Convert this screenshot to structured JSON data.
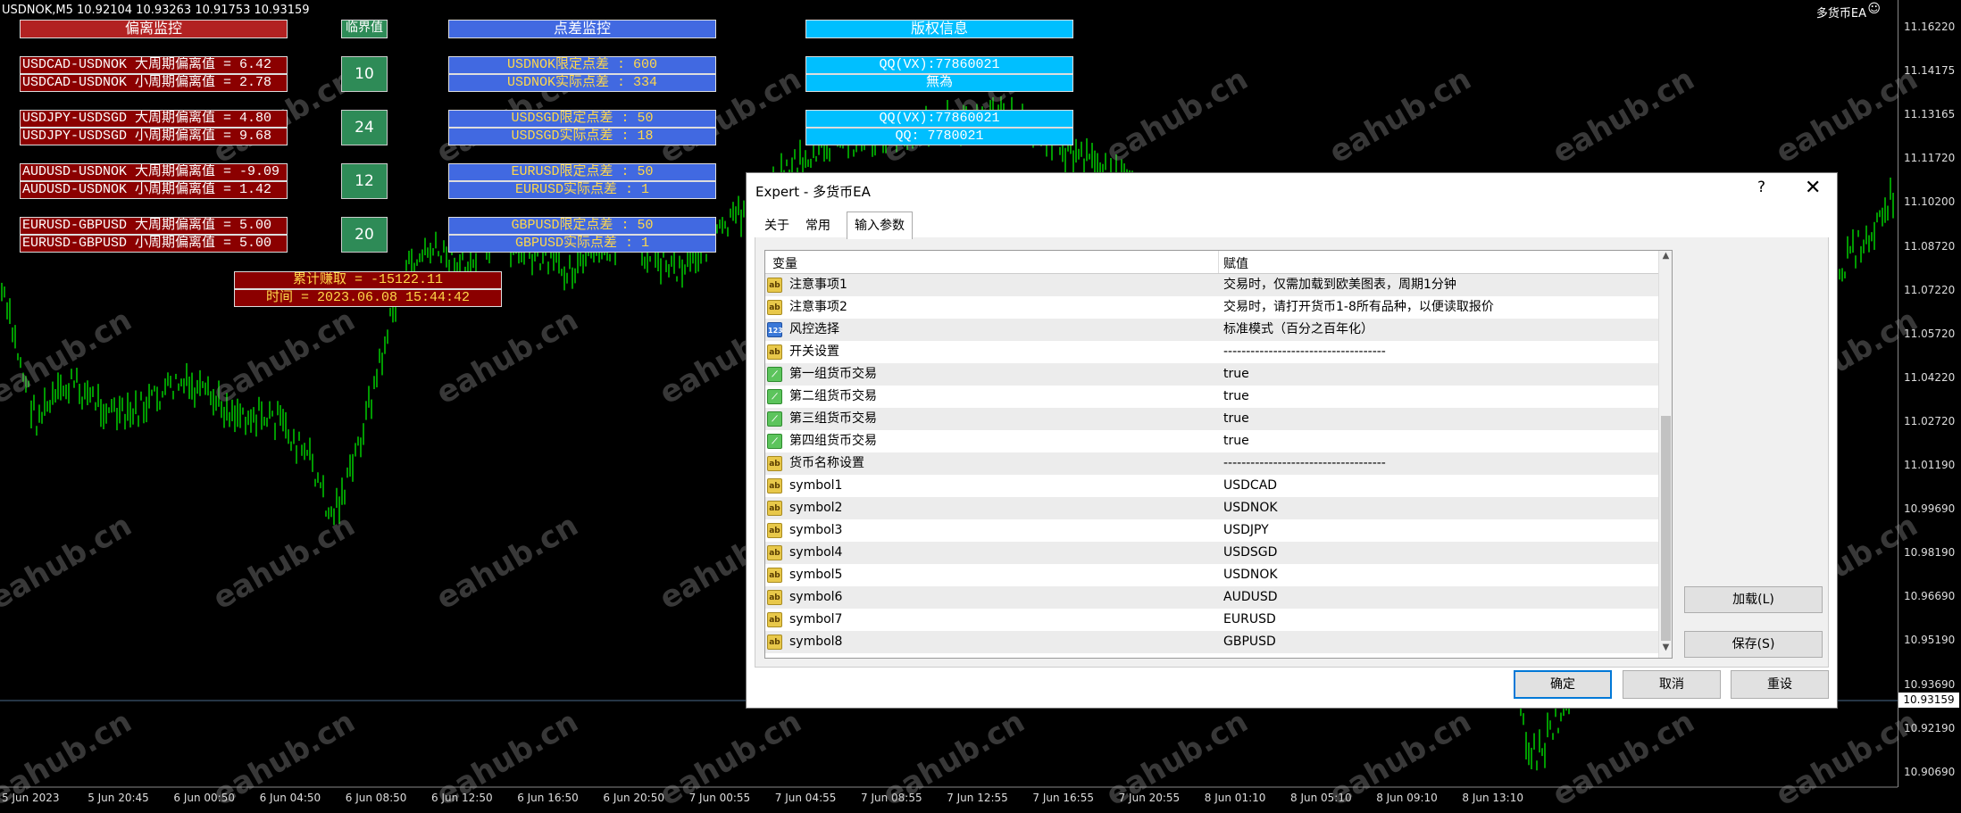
{
  "chart": {
    "title": "USDNOK,M5  10.92104 10.93263 10.91753 10.93159",
    "ea_label": "多货币EA",
    "ea_smile": "☺",
    "price_levels": [
      "11.16220",
      "11.14175",
      "11.13165",
      "11.11720",
      "11.10200",
      "11.08720",
      "11.07220",
      "11.05720",
      "11.04220",
      "11.02720",
      "11.01190",
      "10.99690",
      "10.98190",
      "10.96690",
      "10.95190",
      "10.93690",
      "10.92190",
      "10.90690"
    ],
    "current_price": "10.93159",
    "time_labels": [
      "5 Jun 2023",
      "5 Jun 20:45",
      "6 Jun 00:50",
      "6 Jun 04:50",
      "6 Jun 08:50",
      "6 Jun 12:50",
      "6 Jun 16:50",
      "6 Jun 20:50",
      "7 Jun 00:55",
      "7 Jun 04:55",
      "7 Jun 08:55",
      "7 Jun 12:55",
      "7 Jun 16:55",
      "7 Jun 20:55",
      "8 Jun 01:10",
      "8 Jun 05:10",
      "8 Jun 09:10",
      "8 Jun 13:10"
    ],
    "watermark": "eahub.cn"
  },
  "panels": {
    "deviation_header": "偏离监控",
    "threshold_header": "临界值",
    "spread_header": "点差监控",
    "copyright_header": "版权信息",
    "deviation_rows": [
      "USDCAD-USDNOK 大周期偏离值 = 6.42",
      "USDCAD-USDNOK 小周期偏离值 = 2.78",
      "USDJPY-USDSGD 大周期偏离值 = 4.80",
      "USDJPY-USDSGD 小周期偏离值 = 9.68",
      "AUDUSD-USDNOK 大周期偏离值 = -9.09",
      "AUDUSD-USDNOK 小周期偏离值 = 1.42",
      "EURUSD-GBPUSD 大周期偏离值 = 5.00",
      "EURUSD-GBPUSD 小周期偏离值 = 5.00"
    ],
    "thresholds": [
      "10",
      "24",
      "12",
      "20"
    ],
    "spread_rows": [
      "USDNOK限定点差      : 600",
      "USDNOK实际点差      : 334",
      "USDSGD限定点差      : 50",
      "USDSGD实际点差      : 18",
      "EURUSD限定点差      : 50",
      "EURUSD实际点差      : 1",
      "GBPUSD限定点差      : 50",
      "GBPUSD实际点差      : 1"
    ],
    "copyright_rows": [
      "QQ(VX):77860021",
      "無為",
      "QQ(VX):77860021",
      "QQ: 7780021"
    ],
    "profit": "累计赚取         = -15122.11",
    "time": "时间 = 2023.06.08    15:44:42"
  },
  "dialog": {
    "title": "Expert - 多货币EA",
    "help": "?",
    "close": "✕",
    "tabs": [
      "关于",
      "常用",
      "输入参数"
    ],
    "col_variable": "变量",
    "col_value": "赋值",
    "rows": [
      {
        "icon": "ab",
        "name": "注意事项1",
        "value": "交易时，仅需加载到欧美图表，周期1分钟"
      },
      {
        "icon": "ab",
        "name": "注意事项2",
        "value": "交易时，请打开货币1-8所有品种，以便读取报价"
      },
      {
        "icon": "123",
        "name": "风控选择",
        "value": "标准模式（百分之百年化）"
      },
      {
        "icon": "ab",
        "name": "开关设置",
        "value": "------------------------------------"
      },
      {
        "icon": "bool",
        "name": "第一组货币交易",
        "value": "true"
      },
      {
        "icon": "bool",
        "name": "第二组货币交易",
        "value": "true"
      },
      {
        "icon": "bool",
        "name": "第三组货币交易",
        "value": "true"
      },
      {
        "icon": "bool",
        "name": "第四组货币交易",
        "value": "true"
      },
      {
        "icon": "ab",
        "name": "货币名称设置",
        "value": "------------------------------------"
      },
      {
        "icon": "ab",
        "name": "symbol1",
        "value": "USDCAD"
      },
      {
        "icon": "ab",
        "name": "symbol2",
        "value": "USDNOK"
      },
      {
        "icon": "ab",
        "name": "symbol3",
        "value": "USDJPY"
      },
      {
        "icon": "ab",
        "name": "symbol4",
        "value": "USDSGD"
      },
      {
        "icon": "ab",
        "name": "symbol5",
        "value": "USDNOK"
      },
      {
        "icon": "ab",
        "name": "symbol6",
        "value": "AUDUSD"
      },
      {
        "icon": "ab",
        "name": "symbol7",
        "value": "EURUSD"
      },
      {
        "icon": "ab",
        "name": "symbol8",
        "value": "GBPUSD"
      }
    ],
    "buttons": {
      "load": "加载(L)",
      "save": "保存(S)",
      "ok": "确定",
      "cancel": "取消",
      "reset": "重设"
    },
    "icon_labels": {
      "ab": "ab",
      "123": "123",
      "bool": "⟋"
    }
  }
}
